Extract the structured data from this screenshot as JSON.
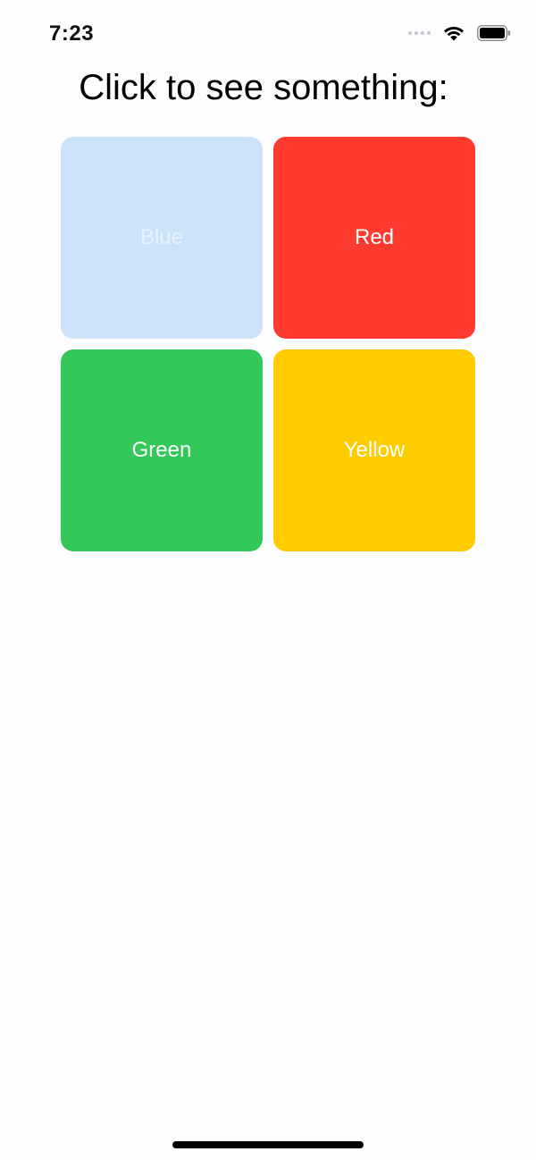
{
  "status_bar": {
    "time": "7:23",
    "icons": [
      "cellular-signal-icon",
      "wifi-icon",
      "battery-icon"
    ]
  },
  "title": "Click to see something:",
  "tiles": [
    {
      "label": "Blue",
      "color": "#cce2f9",
      "state": "pressed"
    },
    {
      "label": "Red",
      "color": "#ff3b30",
      "state": "normal"
    },
    {
      "label": "Green",
      "color": "#34c759",
      "state": "normal"
    },
    {
      "label": "Yellow",
      "color": "#ffcc00",
      "state": "normal"
    }
  ],
  "colors": {
    "background": "#fdfcfe",
    "text": "#000000",
    "tile_text": "#ffffff"
  }
}
